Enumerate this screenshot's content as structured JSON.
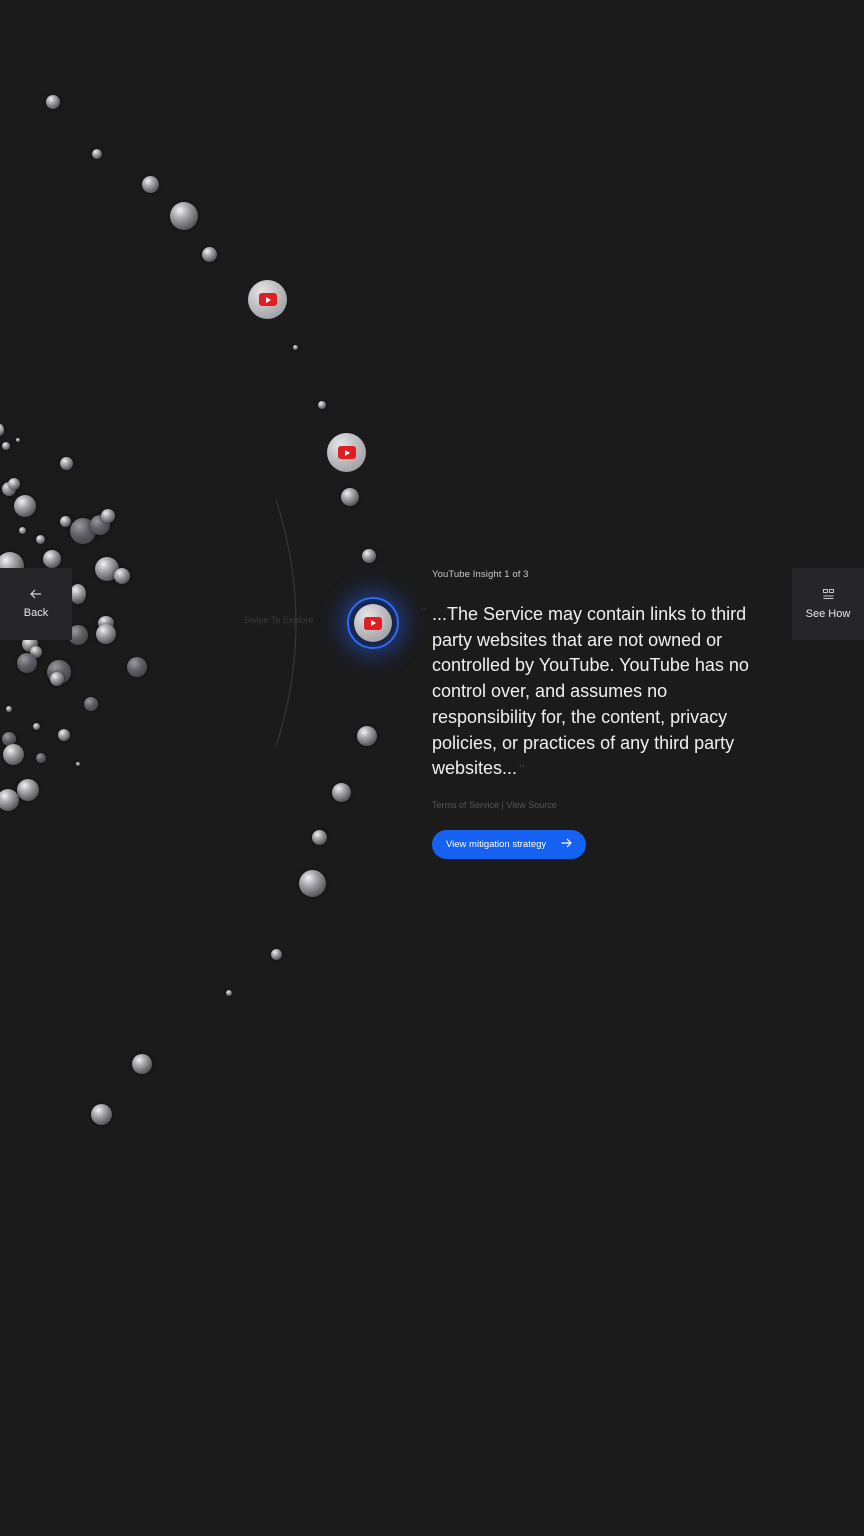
{
  "nav": {
    "back_label": "Back",
    "back_icon": "arrow-left-icon",
    "see_how_label": "See How",
    "see_how_icon": "grid-icon"
  },
  "explore": {
    "swipe_hint": "Swipe To Explore"
  },
  "insight": {
    "counter": "YouTube Insight 1 of 3",
    "quote": "...The Service may contain links to third party websites that are not owned or controlled by YouTube. YouTube has no control over, and assumes no responsibility for, the content, privacy policies, or practices of any third party websites...",
    "quote_open_mark": "“",
    "quote_close_mark": "”",
    "terms_link": "Terms of Service",
    "separator": "|",
    "source_link": "View Source",
    "cta_label": "View mitigation strategy",
    "cta_icon": "arrow-right-icon"
  },
  "colors": {
    "background": "#1b1b1c",
    "accent": "#1561f2",
    "youtube_red": "#e01e22"
  }
}
